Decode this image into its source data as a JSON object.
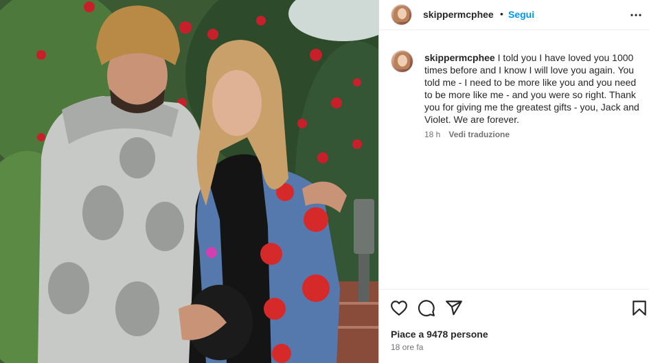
{
  "post": {
    "username": "skippermcphee",
    "separator": "•",
    "follow_label": "Segui",
    "more_icon": "more-options-icon",
    "photo_alt": "Photo of a couple standing in front of greenery and red roses"
  },
  "caption": {
    "username": "skippermcphee",
    "text": " I told you I have loved you 1000 times before and I know I will love you again. You told me - I need to be more like you and you need to be more like me - and you were so right. Thank you for giving me the greatest gifts - you, Jack and Violet. We are forever.",
    "age": "18 h",
    "translate_label": "Vedi traduzione"
  },
  "actions": {
    "icons": [
      "heart-icon",
      "comment-icon",
      "share-icon",
      "bookmark-icon"
    ],
    "likes_text": "Piace a 9478 persone",
    "timestamp": "18 ore fa"
  },
  "colors": {
    "link_blue": "#0095f6",
    "text": "#262626",
    "secondary": "#737373",
    "border": "#dbdbdb"
  }
}
